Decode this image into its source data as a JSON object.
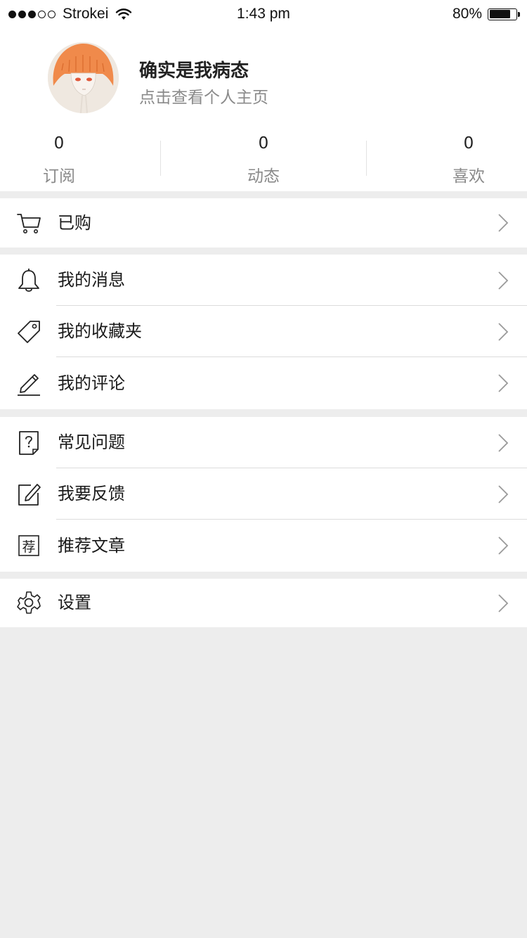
{
  "status_bar": {
    "signal_dots_full": 3,
    "signal_dots_empty": 2,
    "carrier": "Strokei",
    "time": "1:43 pm",
    "battery_percent": "80%",
    "battery_level": 0.8
  },
  "profile": {
    "name": "确实是我病态",
    "subtitle": "点击查看个人主页",
    "stats": [
      {
        "count": "0",
        "label": "订阅"
      },
      {
        "count": "0",
        "label": "动态"
      },
      {
        "count": "0",
        "label": "喜欢"
      }
    ]
  },
  "menu_groups": [
    {
      "items": [
        {
          "label": "已购",
          "icon": "cart-icon"
        }
      ]
    },
    {
      "items": [
        {
          "label": "我的消息",
          "icon": "bell-icon"
        },
        {
          "label": "我的收藏夹",
          "icon": "tag-icon"
        },
        {
          "label": "我的评论",
          "icon": "pencil-icon"
        }
      ]
    },
    {
      "items": [
        {
          "label": "常见问题",
          "icon": "question-doc-icon"
        },
        {
          "label": "我要反馈",
          "icon": "edit-box-icon"
        },
        {
          "label": "推荐文章",
          "icon": "recommend-icon",
          "icon_glyph": "荐"
        }
      ]
    },
    {
      "items": [
        {
          "label": "设置",
          "icon": "gear-icon"
        }
      ]
    }
  ],
  "colors": {
    "background": "#ededed",
    "card": "#ffffff",
    "primary_text": "#1a1a1a",
    "secondary_text": "#8a8a8a",
    "separator": "#dcdcdc",
    "avatar_hair": "#f08a4b"
  }
}
